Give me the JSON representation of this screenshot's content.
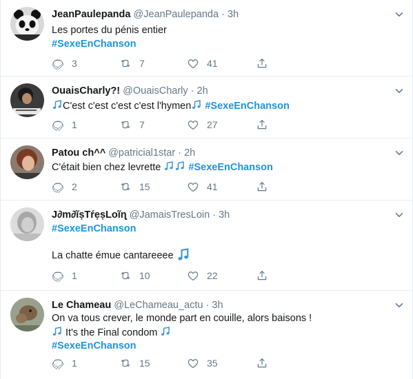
{
  "tweets": [
    {
      "name": "JeanPaulepanda",
      "handle": "@JeanPaulepanda",
      "time": "3h",
      "line1": "Les portes du pénis entier",
      "hashtag": "#SexeEnChanson",
      "replies": "3",
      "retweets": "7",
      "likes": "41"
    },
    {
      "name": "OuaisCharly?!",
      "handle": "@OuaisCharly",
      "time": "2h",
      "text": "C'est c'est c'est c'est l'hymen",
      "hashtag": "#SexeEnChanson",
      "replies": "1",
      "retweets": "7",
      "likes": "27"
    },
    {
      "name": "Patou ch^^",
      "handle": "@patricial1star",
      "time": "2h",
      "text": "C'était bien chez levrette",
      "hashtag": "#SexeEnChanson",
      "replies": "2",
      "retweets": "15",
      "likes": "41"
    },
    {
      "name": "J∂m∂ĩṣTŕẹṣLоĩɳ",
      "handle": "@JamaisTresLoin",
      "time": "3h",
      "hashtag": "#SexeEnChanson",
      "line2": "La chatte émue cantareeee",
      "replies": "1",
      "retweets": "10",
      "likes": "22"
    },
    {
      "name": "Le Chameau",
      "handle": "@LeChameau_actu",
      "time": "3h",
      "line1": "On va tous crever, le monde part en couille, alors baisons !",
      "line2": "It's the Final condom",
      "hashtag": "#SexeEnChanson",
      "replies": "1",
      "retweets": "15",
      "likes": "35"
    }
  ],
  "separator": "·",
  "icons": {
    "reply": "reply-icon",
    "retweet": "retweet-icon",
    "like": "heart-icon",
    "share": "share-icon",
    "caret": "chevron-down-icon",
    "music": "music-note-icon"
  },
  "colors": {
    "hashtag": "#1b95e0",
    "muted": "#657786",
    "text": "#14171a",
    "divider": "#e6ecf0"
  }
}
